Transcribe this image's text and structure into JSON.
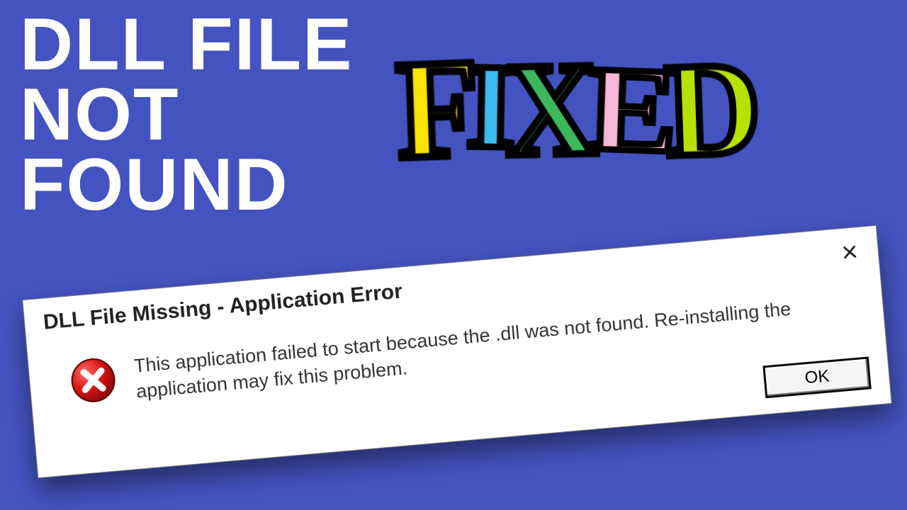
{
  "headline": {
    "line1": "DLL FILE",
    "line2": "NOT",
    "line3": "FOUND"
  },
  "fixed_word": {
    "letters": [
      "F",
      "I",
      "X",
      "E",
      "D"
    ],
    "colors": [
      "#f7e400",
      "#3dbaf0",
      "#3cb85a",
      "#f7b8d8",
      "#b8e000"
    ]
  },
  "dialog": {
    "title": "DLL File Missing - Application Error",
    "close_glyph": "×",
    "message": "This application failed to start because the .dll was not found. Re-installing the application may fix this problem.",
    "ok_label": "OK"
  }
}
